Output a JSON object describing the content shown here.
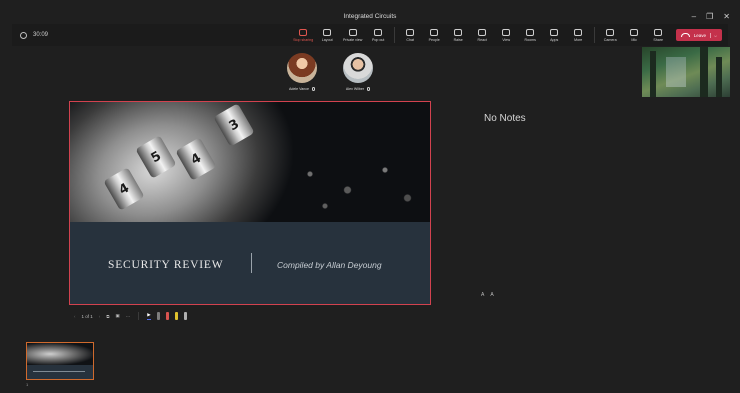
{
  "window": {
    "title": "Integrated Circuits",
    "controls": {
      "minimize": "–",
      "restore": "❐",
      "close": "✕"
    }
  },
  "meeting": {
    "timer": "30:09"
  },
  "toolbar": {
    "share_label": "Stop sharing",
    "layout_label": "Layout",
    "private_view_label": "Private view",
    "popout_label": "Pop out",
    "chat_label": "Chat",
    "people_label": "People",
    "raise_label": "Raise",
    "react_label": "React",
    "view_label": "View",
    "rooms_label": "Rooms",
    "apps_label": "Apps",
    "more_label": "More",
    "camera_label": "Camera",
    "mic_label": "Mic",
    "share2_label": "Share",
    "leave_label": "Leave"
  },
  "participants": [
    {
      "name": "Adele Vance"
    },
    {
      "name": "Alex Wilber"
    }
  ],
  "slide": {
    "title": "SECURITY REVIEW",
    "subtitle": "Compiled by Allan Deyoung",
    "lock_digits": [
      "4",
      "5",
      "4",
      "3"
    ]
  },
  "notes": {
    "text": "No Notes",
    "decrease": "A",
    "increase": "A"
  },
  "presenter_controls": {
    "prev": "‹",
    "page": "1 of 1",
    "next": "›",
    "more": "···"
  },
  "thumbnail": {
    "index": "1"
  },
  "colors": {
    "accent_red": "#c4314b",
    "slide_border": "#d2424f",
    "thumb_border": "#d06a2d",
    "background": "#1f1f1f"
  }
}
